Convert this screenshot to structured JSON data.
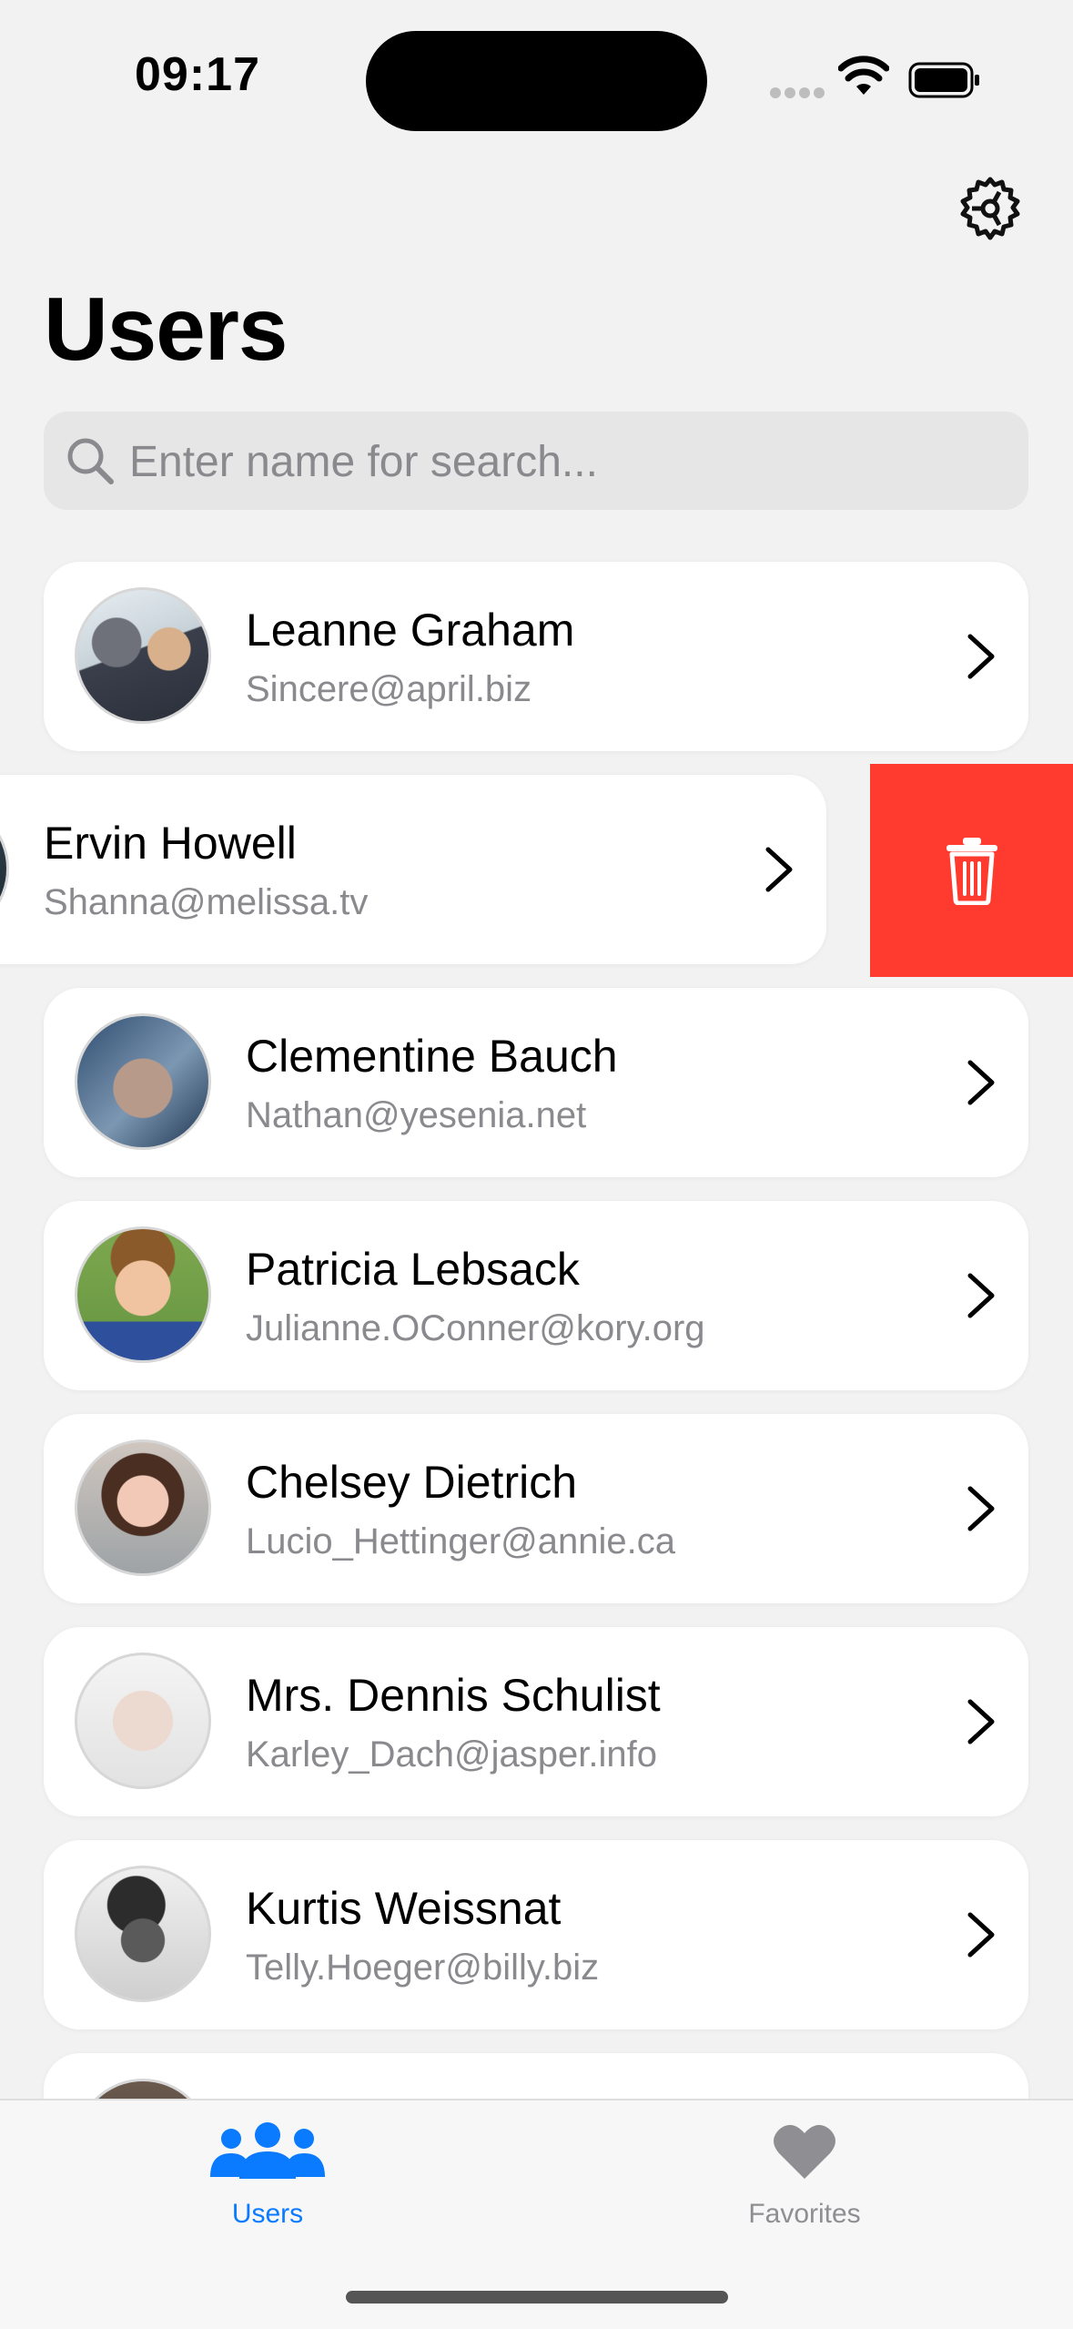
{
  "status_bar": {
    "time": "09:17"
  },
  "header": {
    "title": "Users"
  },
  "search": {
    "placeholder": "Enter name for search..."
  },
  "users": [
    {
      "name": "Leanne Graham",
      "email": "Sincere@april.biz"
    },
    {
      "name": "Ervin Howell",
      "email": "Shanna@melissa.tv"
    },
    {
      "name": "Clementine Bauch",
      "email": "Nathan@yesenia.net"
    },
    {
      "name": "Patricia Lebsack",
      "email": "Julianne.OConner@kory.org"
    },
    {
      "name": "Chelsey Dietrich",
      "email": "Lucio_Hettinger@annie.ca"
    },
    {
      "name": "Mrs. Dennis Schulist",
      "email": "Karley_Dach@jasper.info"
    },
    {
      "name": "Kurtis Weissnat",
      "email": "Telly.Hoeger@billy.biz"
    }
  ],
  "swipe_action": {
    "icon": "trash-icon",
    "color": "#ff3b30"
  },
  "tabbar": {
    "tabs": [
      {
        "label": "Users",
        "icon": "users-icon",
        "active": true
      },
      {
        "label": "Favorites",
        "icon": "heart-icon",
        "active": false
      }
    ],
    "active_color": "#0a7aff",
    "inactive_color": "#8e8e93"
  }
}
